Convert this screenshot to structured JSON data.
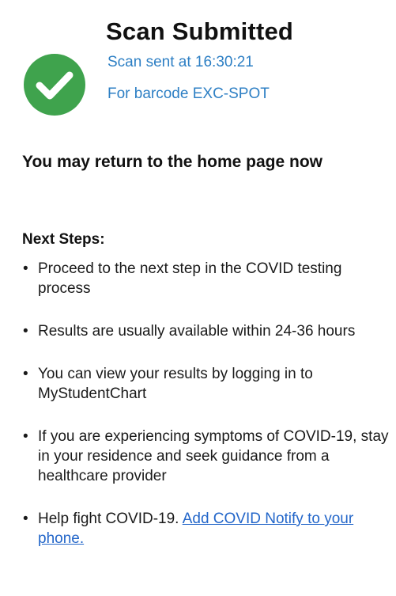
{
  "header": {
    "icon": "check-circle-icon",
    "title": "Scan Submitted",
    "sent_at": "Scan sent at 16:30:21",
    "barcode": "For barcode EXC-SPOT"
  },
  "message": "You may return to the home page now",
  "next_steps": {
    "title": "Next Steps:",
    "items": [
      {
        "text": "Proceed to the next step in the COVID testing process"
      },
      {
        "text": "Results are usually available within 24-36 hours"
      },
      {
        "text": "You can view your results by logging in to MyStudentChart"
      },
      {
        "text": "If you are experiencing symptoms of COVID-19, stay in your residence and seek guidance from a healthcare provider"
      },
      {
        "text": "Help fight COVID-19. ",
        "link": "Add COVID Notify to your phone."
      }
    ]
  },
  "colors": {
    "success_green": "#3fa34d",
    "subtext_blue": "#2d7fc4",
    "link_blue": "#2366c9"
  }
}
